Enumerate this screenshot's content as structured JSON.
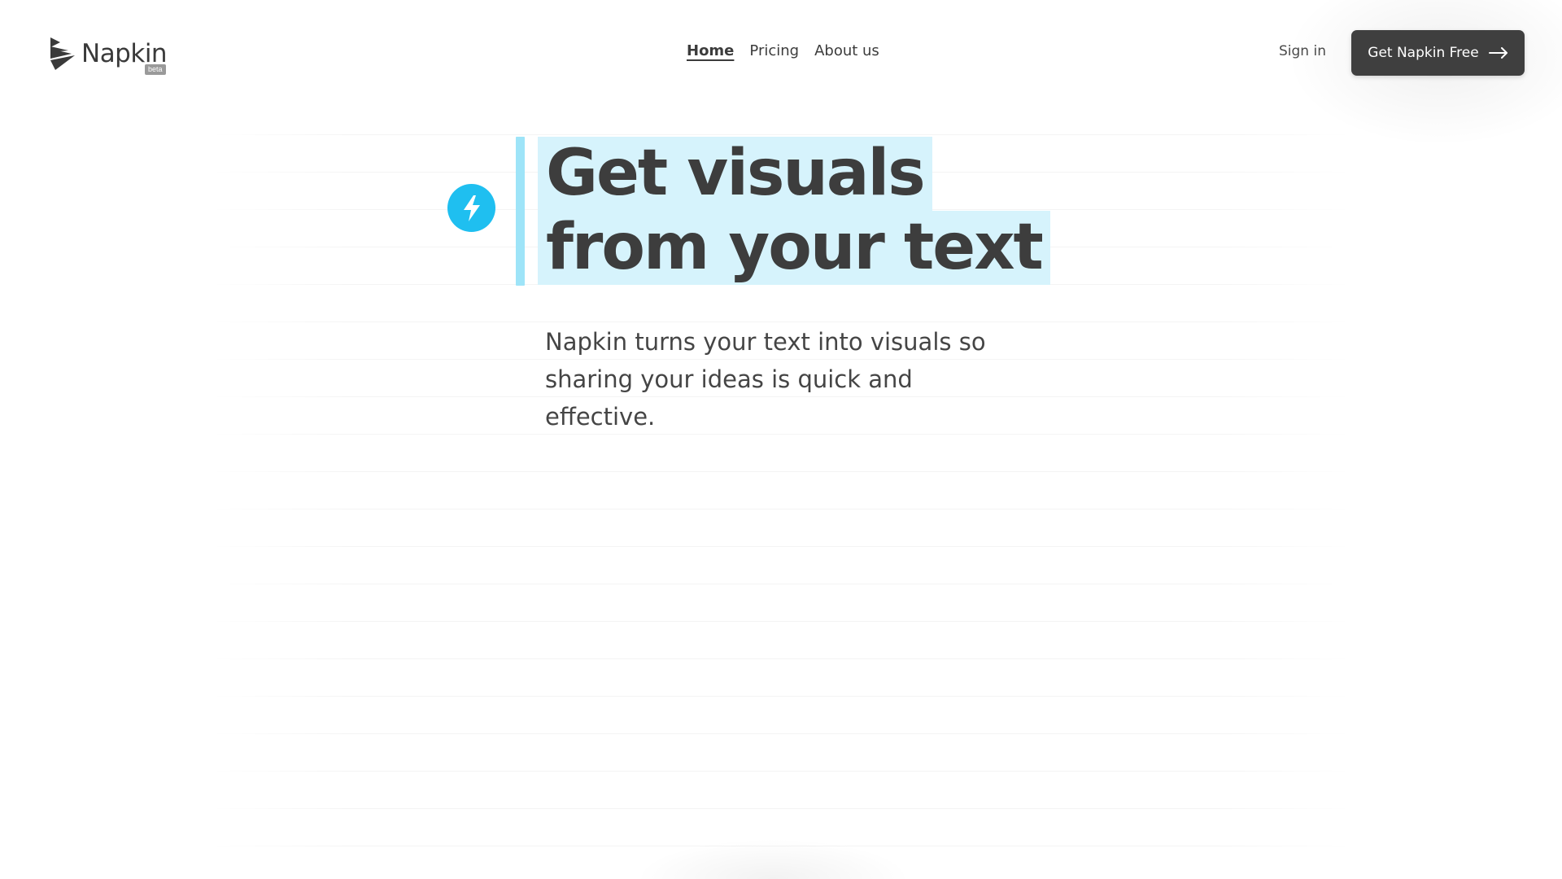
{
  "brand": {
    "name": "Napkin",
    "badge": "beta",
    "logo_icon": "napkin-logo-icon"
  },
  "nav": {
    "items": [
      {
        "label": "Home",
        "active": true
      },
      {
        "label": "Pricing",
        "active": false
      },
      {
        "label": "About us",
        "active": false
      }
    ]
  },
  "header": {
    "signin_label": "Sign in",
    "cta_label": "Get Napkin Free",
    "cta_icon": "arrow-right-icon"
  },
  "hero": {
    "title_line1": "Get visuals",
    "title_line2": "from your text",
    "subtitle": "Napkin turns your text into visuals so sharing your ideas is quick and effective.",
    "badge_icon": "lightning-bolt-icon"
  },
  "colors": {
    "accent": "#1fbff0",
    "highlight": "#d6f3fc",
    "accent_bar": "#9ee4f8",
    "cta_bg": "#3f3f3f",
    "text": "#3c3c3c"
  }
}
